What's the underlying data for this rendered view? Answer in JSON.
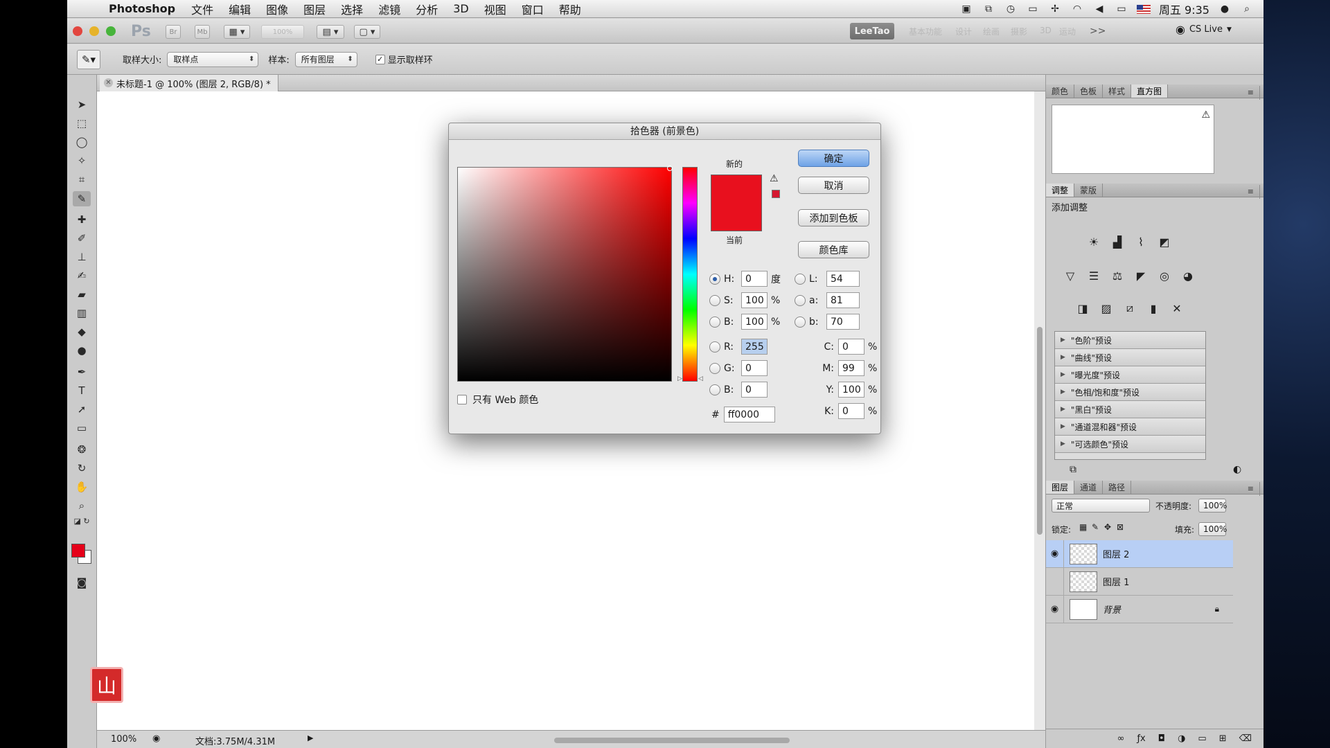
{
  "menubar": {
    "app_name": "Photoshop",
    "items": [
      "文件",
      "编辑",
      "图像",
      "图层",
      "选择",
      "滤镜",
      "分析",
      "3D",
      "视图",
      "窗口",
      "帮助"
    ],
    "clock": "周五 9:35"
  },
  "appbar": {
    "logo": "Ps",
    "btn_br": "Br",
    "btn_mb": "Mb",
    "zoom_value": "100%",
    "workspace_active": "LeeTao",
    "workspace_others": [
      "基本功能",
      "设计",
      "绘画",
      "摄影",
      "3D",
      "运动"
    ],
    "more": ">>",
    "cs_live": "CS Live"
  },
  "options": {
    "sample_size_label": "取样大小:",
    "sample_size_value": "取样点",
    "sample_label": "样本:",
    "sample_value": "所有图层",
    "show_ring_label": "显示取样环",
    "show_ring_checked": true
  },
  "document": {
    "tab_title": "未标题-1 @ 100% (图层 2, RGB/8) *",
    "zoom": "100%",
    "doc_size": "文档:3.75M/4.31M",
    "seal_text": "山"
  },
  "color_picker": {
    "title": "拾色器 (前景色)",
    "new_label": "新的",
    "current_label": "当前",
    "new_color": "#e8101e",
    "current_color": "#e8101e",
    "ok_button": "确定",
    "cancel_button": "取消",
    "add_swatch_button": "添加到色板",
    "color_libraries_button": "颜色库",
    "web_only_label": "只有 Web 颜色",
    "fields": {
      "H": "0",
      "H_unit": "度",
      "S": "100",
      "S_unit": "%",
      "B": "100",
      "B_unit": "%",
      "R": "255",
      "G": "0",
      "Bv": "0",
      "L": "54",
      "a": "81",
      "b": "70",
      "C": "0",
      "M": "99",
      "Y": "100",
      "K": "0",
      "pct": "%"
    },
    "hex_label": "#",
    "hex": "ff0000"
  },
  "right_panels": {
    "top_tabs": [
      "颜色",
      "色板",
      "样式",
      "直方图"
    ],
    "adj_tabs": [
      "调整",
      "蒙版"
    ],
    "adj_title": "添加调整",
    "presets": [
      "\"色阶\"预设",
      "\"曲线\"预设",
      "\"曝光度\"预设",
      "\"色相/饱和度\"预设",
      "\"黑白\"预设",
      "\"通道混和器\"预设",
      "\"可选颜色\"预设"
    ],
    "layer_tabs": [
      "图层",
      "通道",
      "路径"
    ],
    "blend_mode": "正常",
    "opacity_label": "不透明度:",
    "opacity_value": "100%",
    "lock_label": "锁定:",
    "fill_label": "填充:",
    "fill_value": "100%",
    "layers": [
      "图层 2",
      "图层 1",
      "背景"
    ]
  },
  "colors": {
    "foreground": "#e50019",
    "layer_highlight": "#b8cff5"
  }
}
